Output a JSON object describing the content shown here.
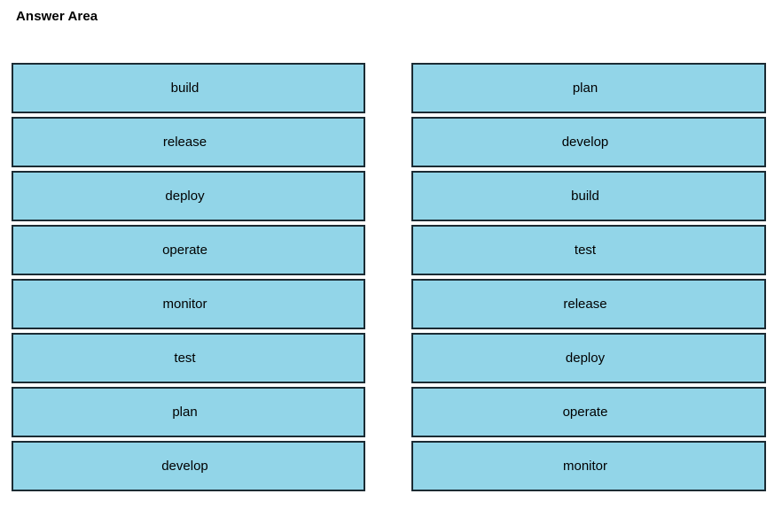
{
  "page": {
    "title": "Answer Area",
    "background_color": "#ffffff"
  },
  "style": {
    "box_fill_color": "#92d5e8",
    "box_border_color": "#1b2b33",
    "text_color": "#000000"
  },
  "answer_area": {
    "columns": [
      {
        "name": "left-column",
        "items": [
          {
            "label": "build"
          },
          {
            "label": "release"
          },
          {
            "label": "deploy"
          },
          {
            "label": "operate"
          },
          {
            "label": "monitor"
          },
          {
            "label": "test"
          },
          {
            "label": "plan"
          },
          {
            "label": "develop"
          }
        ]
      },
      {
        "name": "right-column",
        "items": [
          {
            "label": "plan"
          },
          {
            "label": "develop"
          },
          {
            "label": "build"
          },
          {
            "label": "test"
          },
          {
            "label": "release"
          },
          {
            "label": "deploy"
          },
          {
            "label": "operate"
          },
          {
            "label": "monitor"
          }
        ]
      }
    ]
  }
}
